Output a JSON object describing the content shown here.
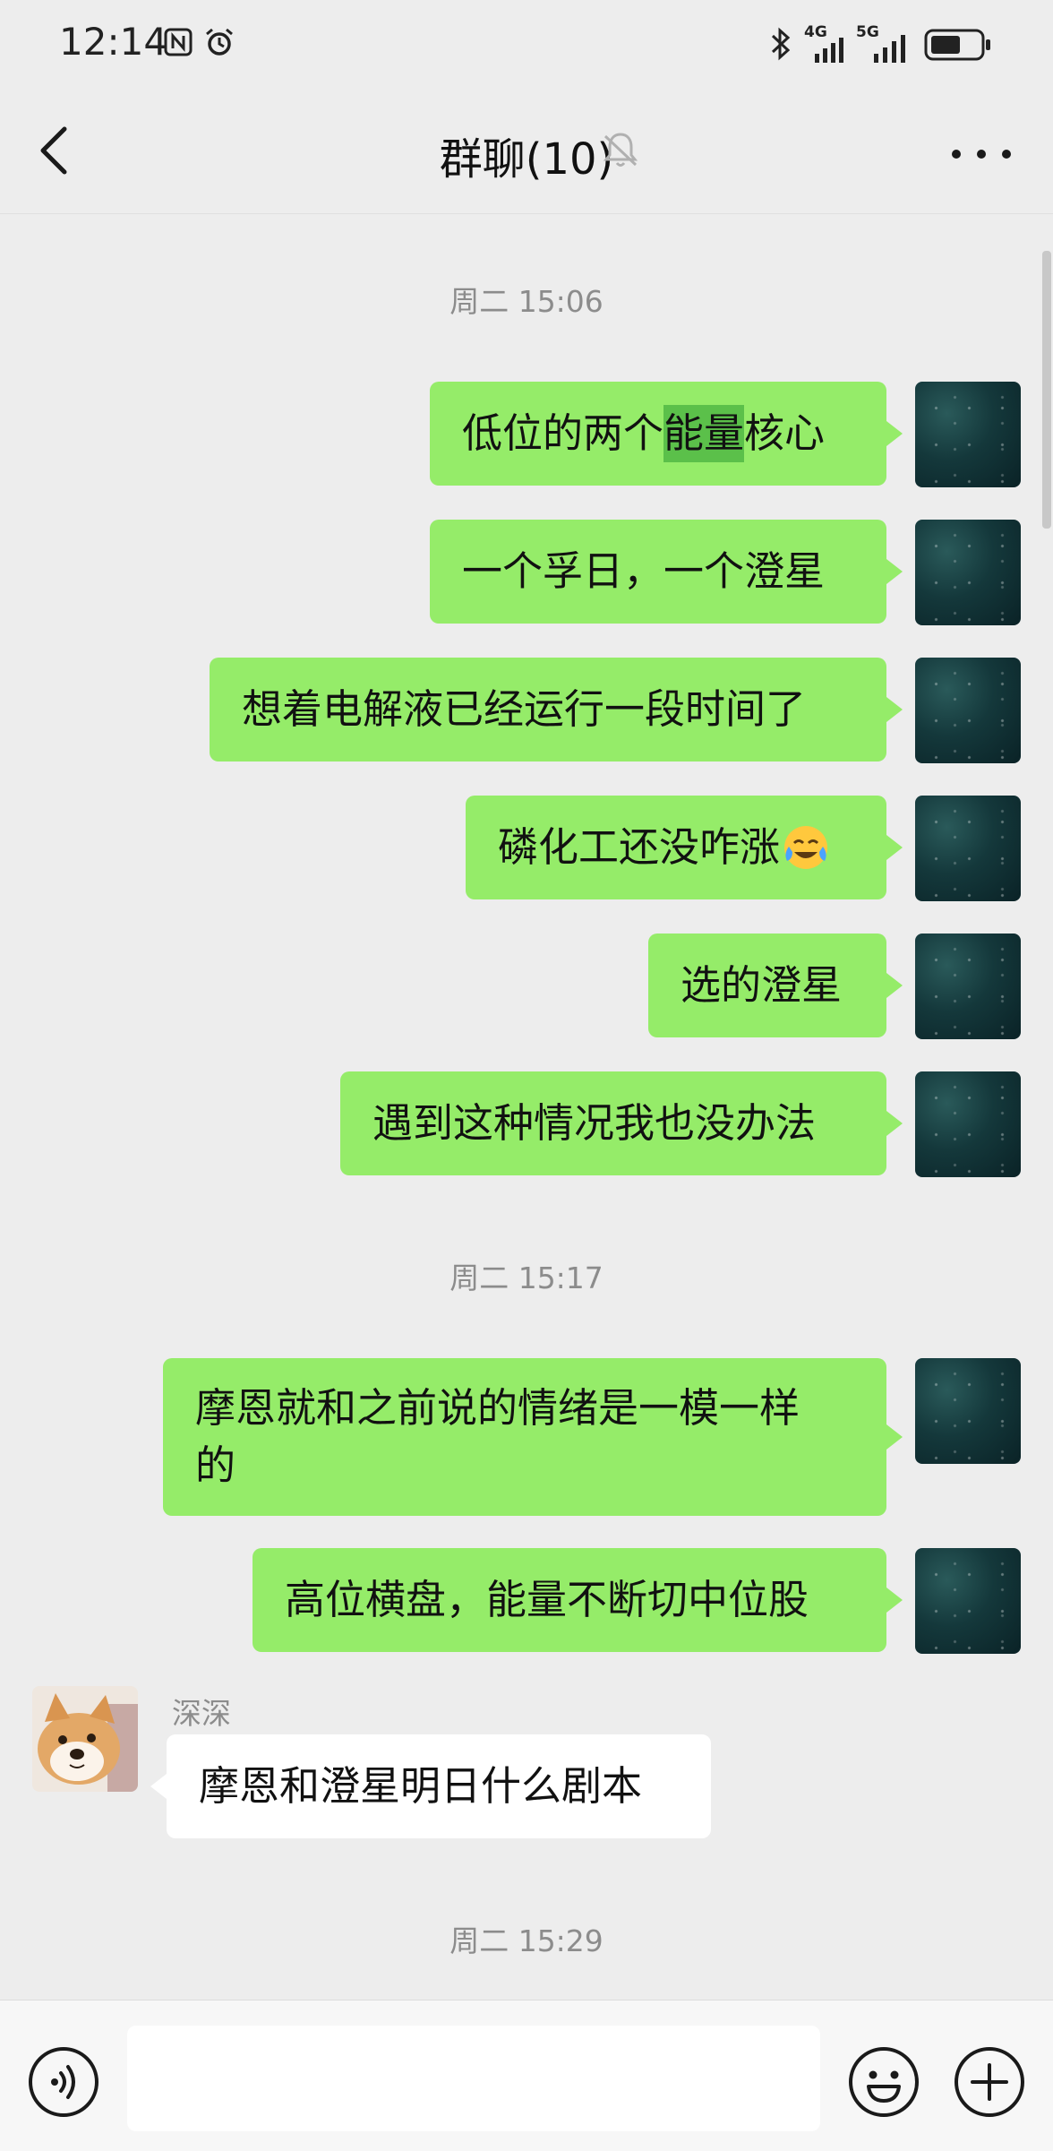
{
  "status_bar": {
    "time": "12:14",
    "network_1": "4G",
    "network_2": "5G",
    "icons": [
      "nfc-icon",
      "alarm-icon",
      "bluetooth-icon",
      "signal-4g-icon",
      "signal-5g-icon",
      "battery-icon"
    ]
  },
  "header": {
    "title": "群聊(10)",
    "icons": [
      "back-icon",
      "mute-bell-icon",
      "more-icon"
    ]
  },
  "messages": {
    "ts1": "周二 15:06",
    "m1a": "低位的两个",
    "m1b": "能量",
    "m1c": "核心",
    "m2": "一个孚日，一个澄星",
    "m3": "想着电解液已经运行一段时间了",
    "m4": "磷化工还没咋涨",
    "m4_emoji": "crying-laughing-emoji-icon",
    "m5": "选的澄星",
    "m6": "遇到这种情况我也没办法",
    "ts2": "周二 15:17",
    "m7a": "摩恩就和之前说的情绪是一模一样",
    "m7b": "的",
    "m8": "高位横盘，能量不断切中位股",
    "sender": "深深",
    "m9": "摩恩和澄星明日什么剧本",
    "ts3": "周二 15:29"
  },
  "input_bar": {
    "placeholder": "",
    "icons": [
      "voice-icon",
      "emoji-icon",
      "plus-icon"
    ]
  },
  "colors": {
    "outgoing_bubble": "#95ec69",
    "incoming_bubble": "#ffffff",
    "background": "#ededed",
    "highlight": "#5bc04a"
  }
}
